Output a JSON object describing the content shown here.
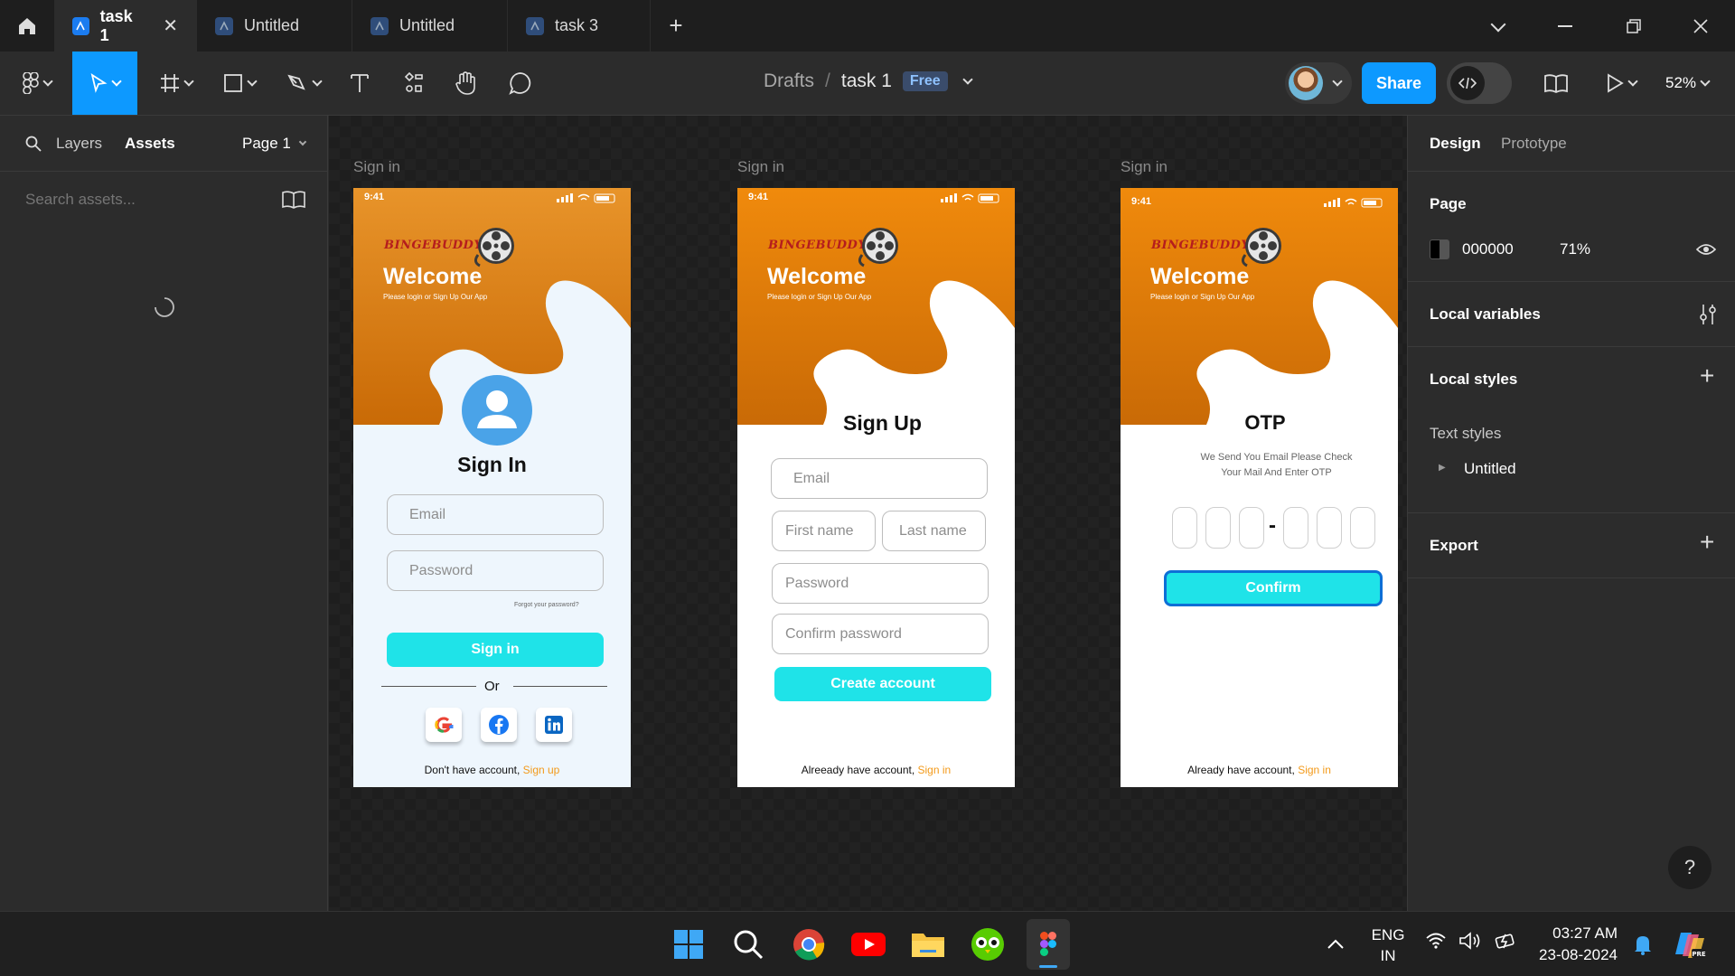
{
  "tabs": [
    {
      "label": "task 1",
      "active": true
    },
    {
      "label": "Untitled",
      "active": false
    },
    {
      "label": "Untitled",
      "active": false
    },
    {
      "label": "task 3",
      "active": false
    }
  ],
  "toolbar": {
    "breadcrumb_root": "Drafts",
    "breadcrumb_sep": "/",
    "file_name": "task 1",
    "plan_badge": "Free",
    "share_label": "Share",
    "zoom": "52%"
  },
  "left_panel": {
    "tab_layers": "Layers",
    "tab_assets": "Assets",
    "page_select": "Page 1",
    "search_placeholder": "Search assets..."
  },
  "right_panel": {
    "tab_design": "Design",
    "tab_prototype": "Prototype",
    "page_heading": "Page",
    "page_color": "000000",
    "page_opacity": "71%",
    "local_variables": "Local variables",
    "local_styles": "Local styles",
    "text_styles": "Text styles",
    "text_style_item": "Untitled",
    "export": "Export"
  },
  "frames": [
    {
      "label": "Sign in",
      "time": "9:41",
      "brand": "BINGEBUDDY",
      "welcome": "Welcome",
      "tagline": "Please login or Sign Up Our App",
      "heading": "Sign In",
      "email": "Email",
      "password": "Password",
      "forgot": "Forgot your password?",
      "cta": "Sign in",
      "or": "Or",
      "footer_text": "Don't have account, ",
      "footer_link": "Sign up"
    },
    {
      "label": "Sign in",
      "time": "9:41",
      "brand": "BINGEBUDDY",
      "welcome": "Welcome",
      "tagline": "Please login or Sign Up Our App",
      "heading": "Sign Up",
      "email": "Email",
      "first_name": "First name",
      "last_name": "Last name",
      "password": "Password",
      "confirm_password": "Confirm password",
      "cta": "Create account",
      "footer_text": "Alreeady have account, ",
      "footer_link": "Sign in"
    },
    {
      "label": "Sign in",
      "time": "9:41",
      "brand": "BINGEBUDDY",
      "welcome": "Welcome",
      "tagline": "Please login or Sign Up Our App",
      "heading": "OTP",
      "subtext_line1": "We Send You Email Please Check",
      "subtext_line2": "Your Mail And Enter OTP",
      "otp_sep": "-",
      "cta": "Confirm",
      "footer_text": "Already have account, ",
      "footer_link": "Sign in"
    }
  ],
  "taskbar": {
    "lang_line1": "ENG",
    "lang_line2": "IN",
    "time": "03:27 AM",
    "date": "23-08-2024"
  },
  "colors": {
    "accent_blue": "#0d99ff",
    "cta_cyan": "#1fe3e8",
    "brand_orange": "#e08a1e",
    "link_orange": "#f39a1a"
  }
}
